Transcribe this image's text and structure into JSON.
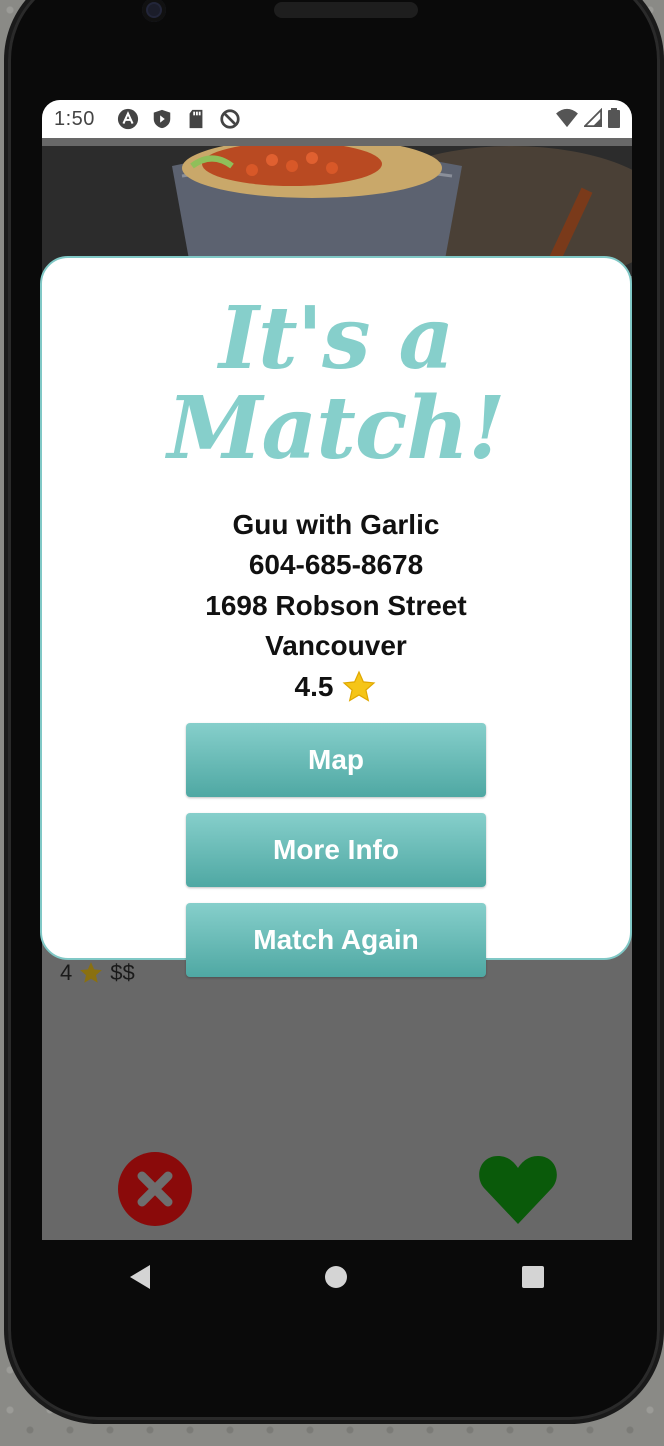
{
  "status_bar": {
    "time": "1:50",
    "left_icons": [
      "a-circle-icon",
      "shield-play-icon",
      "sd-card-icon",
      "no-sync-icon"
    ],
    "right_icons": [
      "wifi-icon",
      "signal-icon",
      "battery-icon"
    ]
  },
  "background_card": {
    "rating": "4",
    "price": "$$"
  },
  "match_dialog": {
    "title": "It's a Match!",
    "restaurant_name": "Guu with Garlic",
    "phone": "604-685-8678",
    "street": "1698 Robson Street",
    "city": "Vancouver",
    "rating": "4.5",
    "buttons": {
      "map": "Map",
      "more_info": "More Info",
      "match_again": "Match Again"
    }
  },
  "actions": {
    "dismiss_icon": "close-circle-icon",
    "like_icon": "heart-icon"
  },
  "colors": {
    "accent": "#86cfcb",
    "button_bottom": "#4fa8a3",
    "dismiss": "#8a0a0a",
    "like": "#0a5a0a",
    "star": "#f5c518"
  }
}
